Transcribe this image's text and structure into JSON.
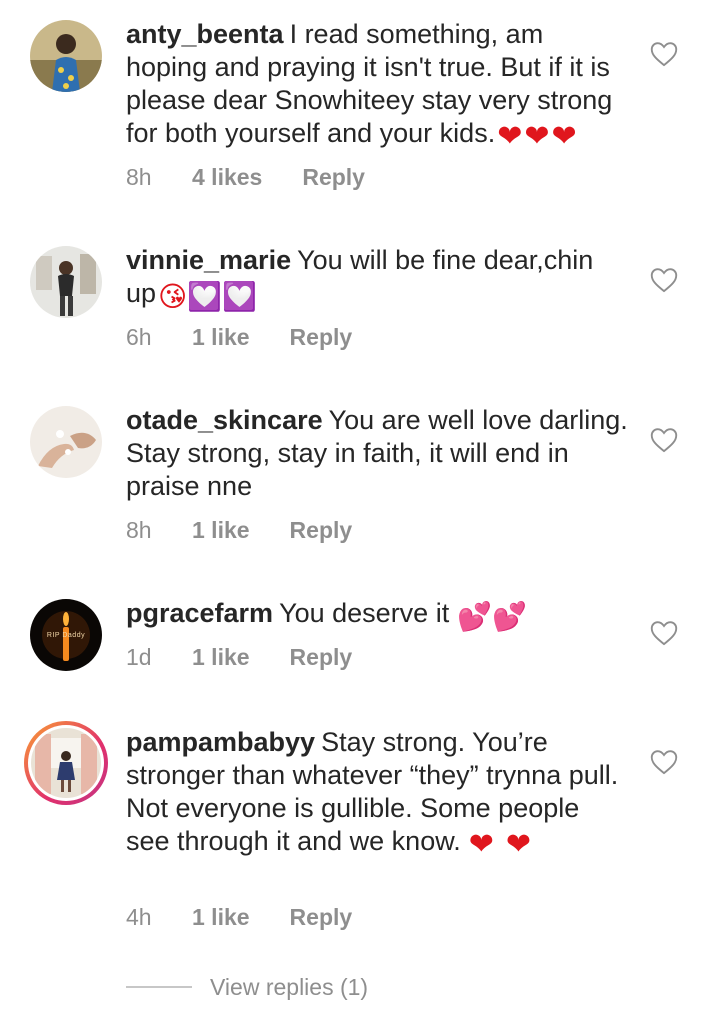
{
  "colors": {
    "text": "#262626",
    "muted": "#8e8e8e",
    "heart_red": "#e0161d",
    "story_ring": "#e1306c"
  },
  "comments": [
    {
      "username": "anty_beenta",
      "text": "I read something, am hoping and praying it isn't true. But if it is please dear Snowhiteey stay very strong for both yourself and your kids.",
      "emoji": "❤❤❤",
      "time": "8h",
      "likes": "4 likes",
      "reply": "Reply",
      "like_icon": "heart-outline-icon"
    },
    {
      "username": "vinnie_marie",
      "text": "You will be fine dear,chin up",
      "emoji": "😘💟💟",
      "time": "6h",
      "likes": "1 like",
      "reply": "Reply",
      "like_icon": "heart-outline-icon"
    },
    {
      "username": "otade_skincare",
      "text": "You are well love darling. Stay strong, stay in faith, it will end in praise nne",
      "time": "8h",
      "likes": "1 like",
      "reply": "Reply",
      "like_icon": "heart-outline-icon"
    },
    {
      "username": "pgracefarm",
      "text": "You deserve it",
      "emoji": "💕💕",
      "avatar_caption": "RIP Daddy",
      "time": "1d",
      "likes": "1 like",
      "reply": "Reply",
      "like_icon": "heart-outline-icon"
    },
    {
      "username": "pampambabyy",
      "text": "Stay strong. You’re stronger than whatever “they” trynna pull. Not everyone is gullible. Some people see through it and we know.",
      "emoji": "❤❤",
      "time": "4h",
      "likes": "1 like",
      "reply": "Reply",
      "like_icon": "heart-outline-icon"
    }
  ],
  "view_replies": "View replies (1)"
}
